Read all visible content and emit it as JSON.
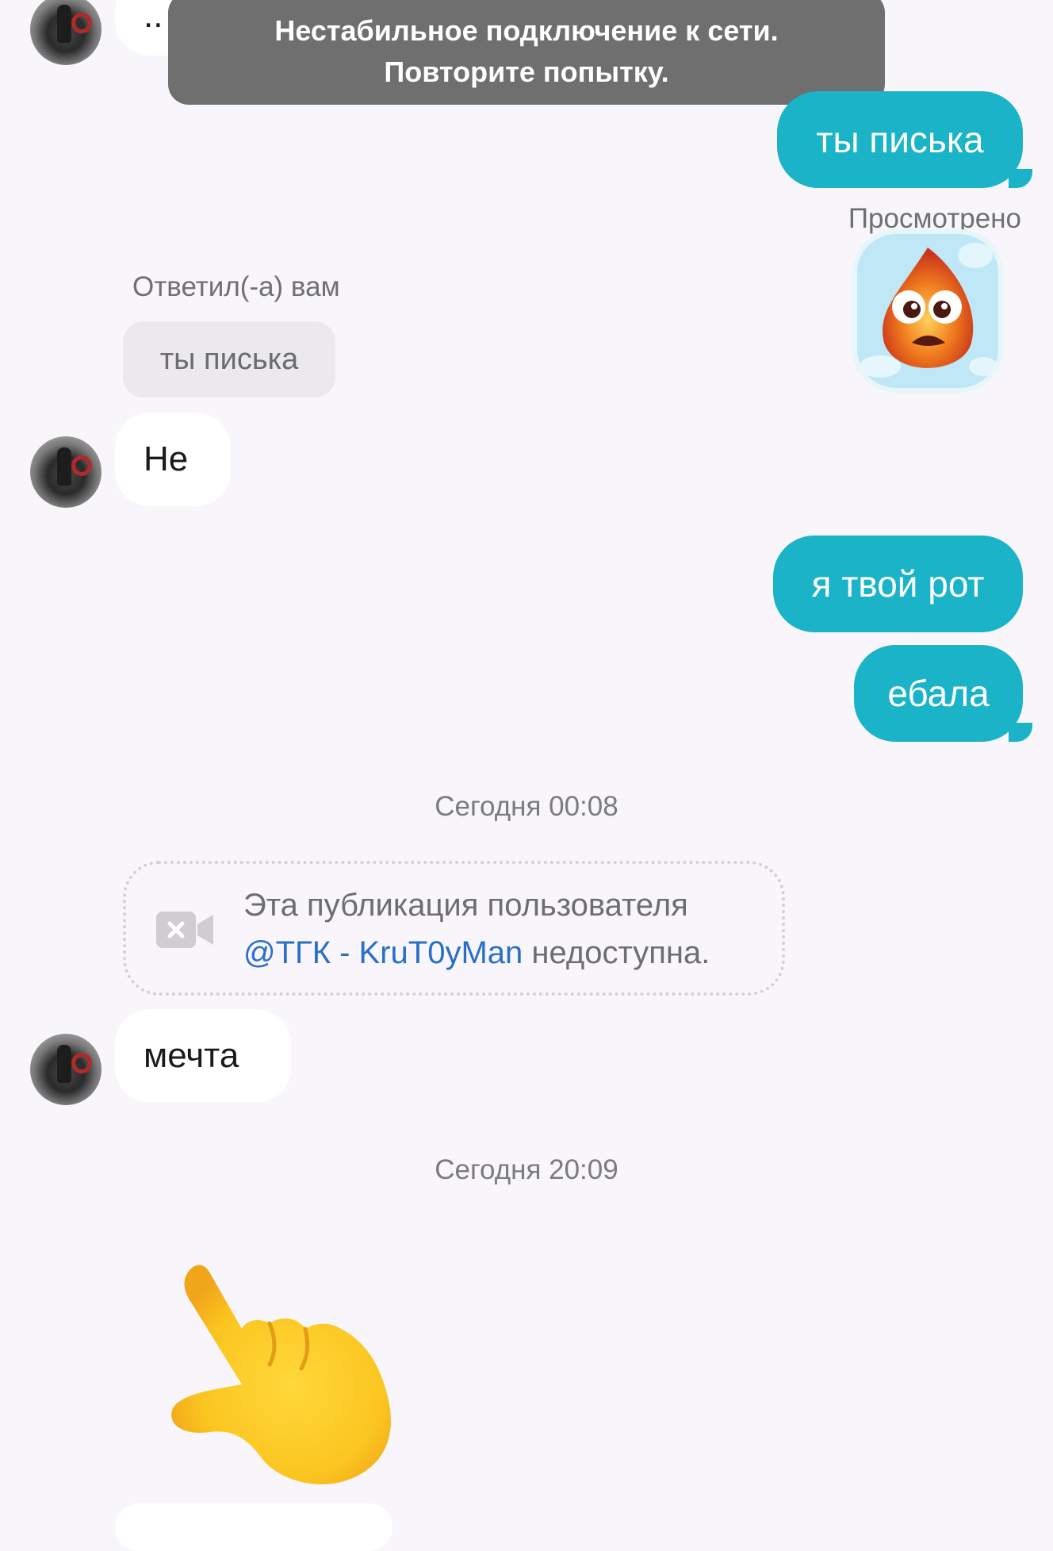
{
  "toast": {
    "line1": "Нестабильное подключение к сети.",
    "line2": "Повторите попытку."
  },
  "messages": {
    "top_partial": "..",
    "out_1": "ты писька",
    "seen_label": "Просмотрено",
    "reply_label": "Ответил(-а) вам",
    "reply_quote": "ты писька",
    "in_1": "Не",
    "out_2": "я твой рот",
    "out_3": "ебала",
    "timestamp_1": "Сегодня 00:08",
    "unavailable_line1": "Эта публикация пользователя",
    "unavailable_mention": "@ТГК - KruT0yMan",
    "unavailable_line2_rest": " недоступна.",
    "in_2": "мечта",
    "timestamp_2": "Сегодня 20:09"
  },
  "icons": {
    "sticker": "crying-fire-ice-sticker",
    "video_unavailable": "video-slash-icon",
    "pointing": "backhand-index-pointing-down-emoji"
  },
  "colors": {
    "outgoing_bubble": "#1bb3c8",
    "incoming_bubble": "#ffffff",
    "mention_link": "#2a6fc7",
    "background": "#f8f6fa"
  }
}
